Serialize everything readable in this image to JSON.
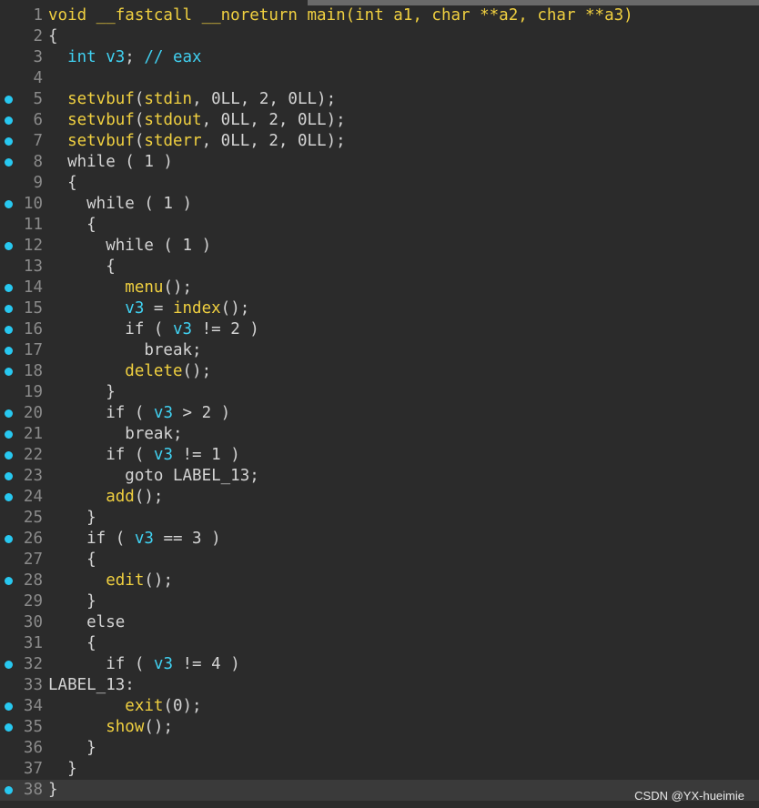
{
  "watermark": "CSDN @YX-hueimie",
  "lines": [
    {
      "n": "1",
      "bp": false,
      "tokens": [
        [
          "fn",
          "void __fastcall __noreturn main(int a1, char **a2, char **a3)"
        ]
      ]
    },
    {
      "n": "2",
      "bp": false,
      "tokens": [
        [
          "plain",
          "{"
        ]
      ]
    },
    {
      "n": "3",
      "bp": false,
      "tokens": [
        [
          "plain",
          "  "
        ],
        [
          "var",
          "int v3"
        ],
        [
          "plain",
          "; "
        ],
        [
          "cmt",
          "// eax"
        ]
      ]
    },
    {
      "n": "4",
      "bp": false,
      "tokens": []
    },
    {
      "n": "5",
      "bp": true,
      "tokens": [
        [
          "plain",
          "  "
        ],
        [
          "fn",
          "setvbuf"
        ],
        [
          "plain",
          "("
        ],
        [
          "fn",
          "stdin"
        ],
        [
          "plain",
          ", 0LL, 2, 0LL);"
        ]
      ]
    },
    {
      "n": "6",
      "bp": true,
      "tokens": [
        [
          "plain",
          "  "
        ],
        [
          "fn",
          "setvbuf"
        ],
        [
          "plain",
          "("
        ],
        [
          "fn",
          "stdout"
        ],
        [
          "plain",
          ", 0LL, 2, 0LL);"
        ]
      ]
    },
    {
      "n": "7",
      "bp": true,
      "tokens": [
        [
          "plain",
          "  "
        ],
        [
          "fn",
          "setvbuf"
        ],
        [
          "plain",
          "("
        ],
        [
          "fn",
          "stderr"
        ],
        [
          "plain",
          ", 0LL, 2, 0LL);"
        ]
      ]
    },
    {
      "n": "8",
      "bp": true,
      "tokens": [
        [
          "plain",
          "  while ( 1 )"
        ]
      ]
    },
    {
      "n": "9",
      "bp": false,
      "tokens": [
        [
          "plain",
          "  {"
        ]
      ]
    },
    {
      "n": "10",
      "bp": true,
      "tokens": [
        [
          "plain",
          "    while ( 1 )"
        ]
      ]
    },
    {
      "n": "11",
      "bp": false,
      "tokens": [
        [
          "plain",
          "    {"
        ]
      ]
    },
    {
      "n": "12",
      "bp": true,
      "tokens": [
        [
          "plain",
          "      while ( 1 )"
        ]
      ]
    },
    {
      "n": "13",
      "bp": false,
      "tokens": [
        [
          "plain",
          "      {"
        ]
      ]
    },
    {
      "n": "14",
      "bp": true,
      "tokens": [
        [
          "plain",
          "        "
        ],
        [
          "fn",
          "menu"
        ],
        [
          "plain",
          "();"
        ]
      ]
    },
    {
      "n": "15",
      "bp": true,
      "tokens": [
        [
          "plain",
          "        "
        ],
        [
          "var",
          "v3"
        ],
        [
          "plain",
          " = "
        ],
        [
          "fn",
          "index"
        ],
        [
          "plain",
          "();"
        ]
      ]
    },
    {
      "n": "16",
      "bp": true,
      "tokens": [
        [
          "plain",
          "        if ( "
        ],
        [
          "var",
          "v3"
        ],
        [
          "plain",
          " != 2 )"
        ]
      ]
    },
    {
      "n": "17",
      "bp": true,
      "tokens": [
        [
          "plain",
          "          break;"
        ]
      ]
    },
    {
      "n": "18",
      "bp": true,
      "tokens": [
        [
          "plain",
          "        "
        ],
        [
          "fn",
          "delete"
        ],
        [
          "plain",
          "();"
        ]
      ]
    },
    {
      "n": "19",
      "bp": false,
      "tokens": [
        [
          "plain",
          "      }"
        ]
      ]
    },
    {
      "n": "20",
      "bp": true,
      "tokens": [
        [
          "plain",
          "      if ( "
        ],
        [
          "var",
          "v3"
        ],
        [
          "plain",
          " > 2 )"
        ]
      ]
    },
    {
      "n": "21",
      "bp": true,
      "tokens": [
        [
          "plain",
          "        break;"
        ]
      ]
    },
    {
      "n": "22",
      "bp": true,
      "tokens": [
        [
          "plain",
          "      if ( "
        ],
        [
          "var",
          "v3"
        ],
        [
          "plain",
          " != 1 )"
        ]
      ]
    },
    {
      "n": "23",
      "bp": true,
      "tokens": [
        [
          "plain",
          "        goto LABEL_13;"
        ]
      ]
    },
    {
      "n": "24",
      "bp": true,
      "tokens": [
        [
          "plain",
          "      "
        ],
        [
          "fn",
          "add"
        ],
        [
          "plain",
          "();"
        ]
      ]
    },
    {
      "n": "25",
      "bp": false,
      "tokens": [
        [
          "plain",
          "    }"
        ]
      ]
    },
    {
      "n": "26",
      "bp": true,
      "tokens": [
        [
          "plain",
          "    if ( "
        ],
        [
          "var",
          "v3"
        ],
        [
          "plain",
          " == 3 )"
        ]
      ]
    },
    {
      "n": "27",
      "bp": false,
      "tokens": [
        [
          "plain",
          "    {"
        ]
      ]
    },
    {
      "n": "28",
      "bp": true,
      "tokens": [
        [
          "plain",
          "      "
        ],
        [
          "fn",
          "edit"
        ],
        [
          "plain",
          "();"
        ]
      ]
    },
    {
      "n": "29",
      "bp": false,
      "tokens": [
        [
          "plain",
          "    }"
        ]
      ]
    },
    {
      "n": "30",
      "bp": false,
      "tokens": [
        [
          "plain",
          "    else"
        ]
      ]
    },
    {
      "n": "31",
      "bp": false,
      "tokens": [
        [
          "plain",
          "    {"
        ]
      ]
    },
    {
      "n": "32",
      "bp": true,
      "tokens": [
        [
          "plain",
          "      if ( "
        ],
        [
          "var",
          "v3"
        ],
        [
          "plain",
          " != 4 )"
        ]
      ]
    },
    {
      "n": "33",
      "bp": false,
      "tokens": [
        [
          "plain",
          "LABEL_13:"
        ]
      ]
    },
    {
      "n": "34",
      "bp": true,
      "tokens": [
        [
          "plain",
          "        "
        ],
        [
          "fn",
          "exit"
        ],
        [
          "plain",
          "(0);"
        ]
      ]
    },
    {
      "n": "35",
      "bp": true,
      "tokens": [
        [
          "plain",
          "      "
        ],
        [
          "fn",
          "show"
        ],
        [
          "plain",
          "();"
        ]
      ]
    },
    {
      "n": "36",
      "bp": false,
      "tokens": [
        [
          "plain",
          "    }"
        ]
      ]
    },
    {
      "n": "37",
      "bp": false,
      "tokens": [
        [
          "plain",
          "  }"
        ]
      ]
    },
    {
      "n": "38",
      "bp": true,
      "tokens": [
        [
          "plain",
          "}"
        ]
      ],
      "highlight": true
    }
  ]
}
